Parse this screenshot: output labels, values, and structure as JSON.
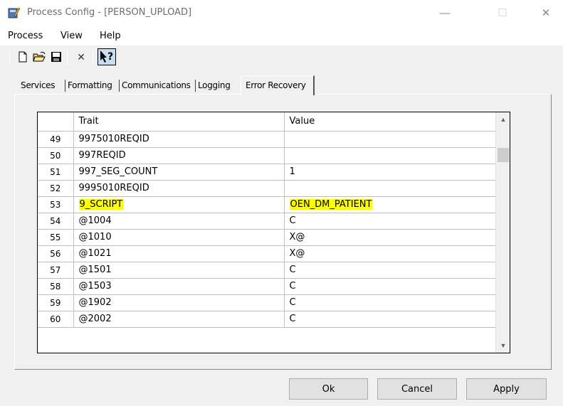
{
  "window": {
    "title": "Process Config - [PERSON_UPLOAD]",
    "minimize_glyph": "—",
    "maximize_glyph": "☐",
    "close_glyph": "✕"
  },
  "menu": [
    "Process",
    "View",
    "Help"
  ],
  "toolbar": {
    "icons": [
      "new-icon",
      "open-folder-icon",
      "save-icon",
      "delete-icon",
      "context-help-icon"
    ],
    "delete_glyph": "✕"
  },
  "tabs": [
    {
      "label": "Services",
      "active": false
    },
    {
      "label": "Formatting",
      "active": false
    },
    {
      "label": "Communications",
      "active": false
    },
    {
      "label": "Logging",
      "active": false
    },
    {
      "label": "Error Recovery",
      "active": true
    }
  ],
  "grid": {
    "headers": {
      "num": "",
      "trait": "Trait",
      "value": "Value"
    },
    "rows": [
      {
        "num": "49",
        "trait": "9975010REQID",
        "value": "",
        "highlight": false
      },
      {
        "num": "50",
        "trait": "997REQID",
        "value": "",
        "highlight": false
      },
      {
        "num": "51",
        "trait": "997_SEG_COUNT",
        "value": "1",
        "highlight": false
      },
      {
        "num": "52",
        "trait": "9995010REQID",
        "value": "",
        "highlight": false
      },
      {
        "num": "53",
        "trait": "9_SCRIPT",
        "value": "OEN_DM_PATIENT",
        "highlight": true
      },
      {
        "num": "54",
        "trait": "@1004",
        "value": "C",
        "highlight": false
      },
      {
        "num": "55",
        "trait": "@1010",
        "value": "X@",
        "highlight": false
      },
      {
        "num": "56",
        "trait": "@1021",
        "value": "X@",
        "highlight": false
      },
      {
        "num": "57",
        "trait": "@1501",
        "value": "C",
        "highlight": false
      },
      {
        "num": "58",
        "trait": "@1503",
        "value": "C",
        "highlight": false
      },
      {
        "num": "59",
        "trait": "@1902",
        "value": "C",
        "highlight": false
      },
      {
        "num": "60",
        "trait": "@2002",
        "value": "C",
        "highlight": false
      }
    ],
    "highlight_color": "#ffff00"
  },
  "scrollbar": {
    "up_glyph": "▲",
    "down_glyph": "▼"
  },
  "buttons": {
    "ok": "Ok",
    "cancel": "Cancel",
    "apply": "Apply"
  }
}
